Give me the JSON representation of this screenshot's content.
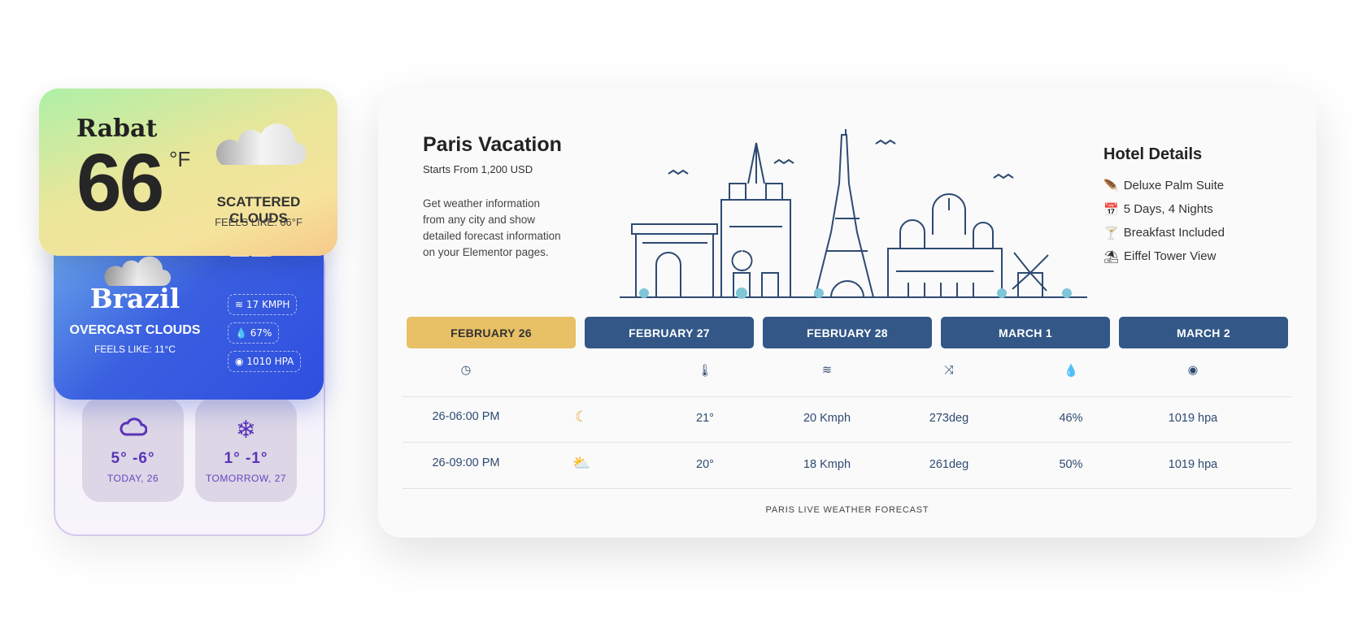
{
  "rabat": {
    "city": "Rabat",
    "temp": "66",
    "unit": "°F",
    "condition": "SCATTERED CLOUDS",
    "feels_like": "FEELS LIKE: 66°F"
  },
  "brazil": {
    "city": "Brazil",
    "temp_partial": "12",
    "condition": "OVERCAST CLOUDS",
    "feels_like": "FEELS LIKE: 11°C",
    "wind": "17 KMPH",
    "humidity": "67%",
    "pressure": "1010 HPA"
  },
  "days": [
    {
      "icon": "cloud-icon",
      "temps": "5°  -6°",
      "label": "TODAY, 26"
    },
    {
      "icon": "snowflake-icon",
      "temps": "1°  -1°",
      "label": "TOMORROW, 27"
    }
  ],
  "paris": {
    "title": "Paris Vacation",
    "price": "Starts From 1,200 USD",
    "description": "Get weather information from any city and show detailed forecast information on your Elementor pages.",
    "hotel": {
      "title": "Hotel Details",
      "items": [
        {
          "icon": "feather-icon",
          "label": "Deluxe Palm Suite"
        },
        {
          "icon": "calendar-icon",
          "label": "5 Days, 4 Nights"
        },
        {
          "icon": "cocktail-icon",
          "label": "Breakfast Included"
        },
        {
          "icon": "beach-umbrella-icon",
          "label": "Eiffel Tower View"
        }
      ]
    },
    "tabs": [
      "FEBRUARY 26",
      "FEBRUARY 27",
      "FEBRUARY 28",
      "MARCH 1",
      "MARCH 2"
    ],
    "active_tab": 0,
    "columns": [
      "clock-icon",
      "condition",
      "thermometer-icon",
      "wind-icon",
      "direction-icon",
      "humidity-icon",
      "pressure-icon"
    ],
    "rows": [
      {
        "time": "26-06:00 PM",
        "icon": "moon-icon",
        "temp": "21°",
        "wind": "20 Kmph",
        "direction": "273deg",
        "humidity": "46%",
        "pressure": "1019 hpa"
      },
      {
        "time": "26-09:00 PM",
        "icon": "partly-cloudy-icon",
        "temp": "20°",
        "wind": "18 Kmph",
        "direction": "261deg",
        "humidity": "50%",
        "pressure": "1019 hpa"
      }
    ],
    "footer": "PARIS LIVE WEATHER FORECAST"
  },
  "colors": {
    "accent": "#e8c065",
    "tab": "#335887",
    "text_blue": "#2e4a72",
    "purple": "#5b33b8"
  }
}
